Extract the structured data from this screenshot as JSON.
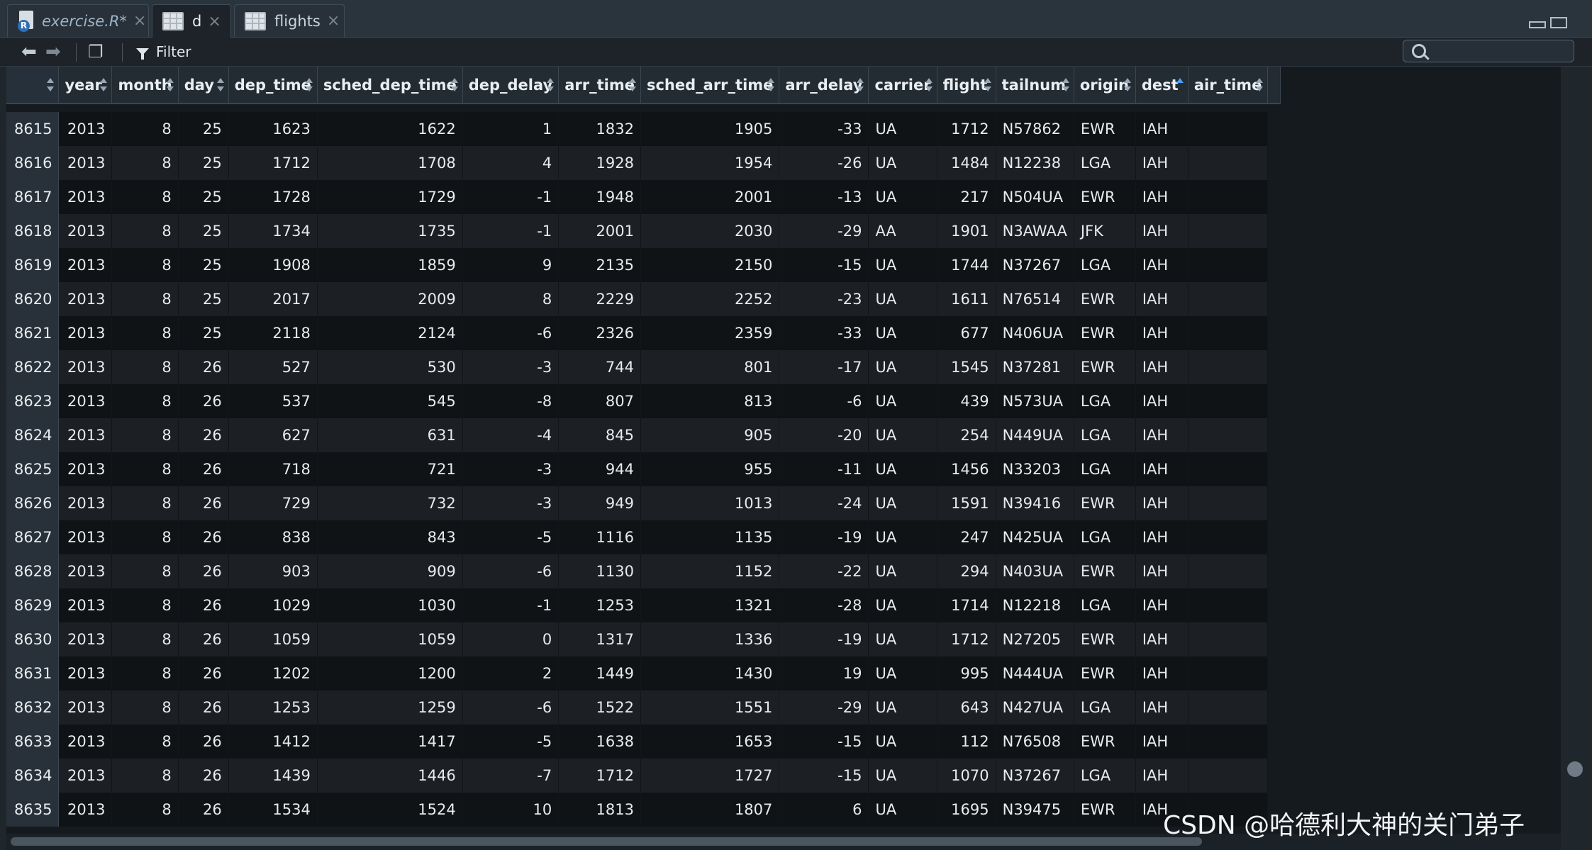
{
  "tabs": [
    {
      "label": "exercise.R*",
      "icon": "r-script-icon"
    },
    {
      "label": "d",
      "icon": "table-grid-icon"
    },
    {
      "label": "flights",
      "icon": "table-grid-icon"
    }
  ],
  "toolbar": {
    "filter_label": "Filter",
    "search_value": ""
  },
  "columns": [
    "year",
    "month",
    "day",
    "dep_time",
    "sched_dep_time",
    "dep_delay",
    "arr_time",
    "sched_arr_time",
    "arr_delay",
    "carrier",
    "flight",
    "tailnum",
    "origin",
    "dest",
    "air_time"
  ],
  "sorted_column": "dest",
  "rows": [
    [
      "8615",
      "2013",
      "8",
      "25",
      "1623",
      "1622",
      "1",
      "1832",
      "1905",
      "-33",
      "UA",
      "1712",
      "N57862",
      "EWR",
      "IAH"
    ],
    [
      "8616",
      "2013",
      "8",
      "25",
      "1712",
      "1708",
      "4",
      "1928",
      "1954",
      "-26",
      "UA",
      "1484",
      "N12238",
      "LGA",
      "IAH"
    ],
    [
      "8617",
      "2013",
      "8",
      "25",
      "1728",
      "1729",
      "-1",
      "1948",
      "2001",
      "-13",
      "UA",
      "217",
      "N504UA",
      "EWR",
      "IAH"
    ],
    [
      "8618",
      "2013",
      "8",
      "25",
      "1734",
      "1735",
      "-1",
      "2001",
      "2030",
      "-29",
      "AA",
      "1901",
      "N3AWAA",
      "JFK",
      "IAH"
    ],
    [
      "8619",
      "2013",
      "8",
      "25",
      "1908",
      "1859",
      "9",
      "2135",
      "2150",
      "-15",
      "UA",
      "1744",
      "N37267",
      "LGA",
      "IAH"
    ],
    [
      "8620",
      "2013",
      "8",
      "25",
      "2017",
      "2009",
      "8",
      "2229",
      "2252",
      "-23",
      "UA",
      "1611",
      "N76514",
      "EWR",
      "IAH"
    ],
    [
      "8621",
      "2013",
      "8",
      "25",
      "2118",
      "2124",
      "-6",
      "2326",
      "2359",
      "-33",
      "UA",
      "677",
      "N406UA",
      "EWR",
      "IAH"
    ],
    [
      "8622",
      "2013",
      "8",
      "26",
      "527",
      "530",
      "-3",
      "744",
      "801",
      "-17",
      "UA",
      "1545",
      "N37281",
      "EWR",
      "IAH"
    ],
    [
      "8623",
      "2013",
      "8",
      "26",
      "537",
      "545",
      "-8",
      "807",
      "813",
      "-6",
      "UA",
      "439",
      "N573UA",
      "LGA",
      "IAH"
    ],
    [
      "8624",
      "2013",
      "8",
      "26",
      "627",
      "631",
      "-4",
      "845",
      "905",
      "-20",
      "UA",
      "254",
      "N449UA",
      "LGA",
      "IAH"
    ],
    [
      "8625",
      "2013",
      "8",
      "26",
      "718",
      "721",
      "-3",
      "944",
      "955",
      "-11",
      "UA",
      "1456",
      "N33203",
      "LGA",
      "IAH"
    ],
    [
      "8626",
      "2013",
      "8",
      "26",
      "729",
      "732",
      "-3",
      "949",
      "1013",
      "-24",
      "UA",
      "1591",
      "N39416",
      "EWR",
      "IAH"
    ],
    [
      "8627",
      "2013",
      "8",
      "26",
      "838",
      "843",
      "-5",
      "1116",
      "1135",
      "-19",
      "UA",
      "247",
      "N425UA",
      "LGA",
      "IAH"
    ],
    [
      "8628",
      "2013",
      "8",
      "26",
      "903",
      "909",
      "-6",
      "1130",
      "1152",
      "-22",
      "UA",
      "294",
      "N403UA",
      "EWR",
      "IAH"
    ],
    [
      "8629",
      "2013",
      "8",
      "26",
      "1029",
      "1030",
      "-1",
      "1253",
      "1321",
      "-28",
      "UA",
      "1714",
      "N12218",
      "LGA",
      "IAH"
    ],
    [
      "8630",
      "2013",
      "8",
      "26",
      "1059",
      "1059",
      "0",
      "1317",
      "1336",
      "-19",
      "UA",
      "1712",
      "N27205",
      "EWR",
      "IAH"
    ],
    [
      "8631",
      "2013",
      "8",
      "26",
      "1202",
      "1200",
      "2",
      "1449",
      "1430",
      "19",
      "UA",
      "995",
      "N444UA",
      "EWR",
      "IAH"
    ],
    [
      "8632",
      "2013",
      "8",
      "26",
      "1253",
      "1259",
      "-6",
      "1522",
      "1551",
      "-29",
      "UA",
      "643",
      "N427UA",
      "LGA",
      "IAH"
    ],
    [
      "8633",
      "2013",
      "8",
      "26",
      "1412",
      "1417",
      "-5",
      "1638",
      "1653",
      "-15",
      "UA",
      "112",
      "N76508",
      "EWR",
      "IAH"
    ],
    [
      "8634",
      "2013",
      "8",
      "26",
      "1439",
      "1446",
      "-7",
      "1712",
      "1727",
      "-15",
      "UA",
      "1070",
      "N37267",
      "LGA",
      "IAH"
    ],
    [
      "8635",
      "2013",
      "8",
      "26",
      "1534",
      "1524",
      "10",
      "1813",
      "1807",
      "6",
      "UA",
      "1695",
      "N39475",
      "EWR",
      "IAH"
    ]
  ],
  "watermark": "CSDN @哈德利大神的关门弟子"
}
